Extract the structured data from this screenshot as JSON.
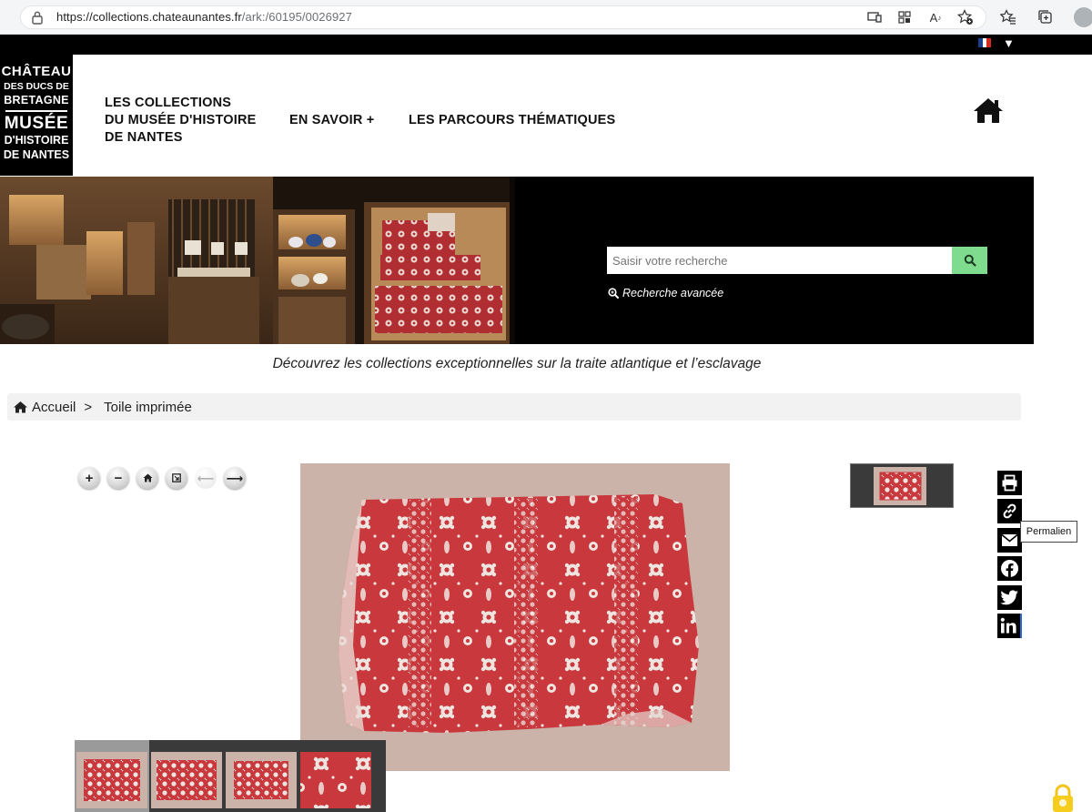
{
  "browser": {
    "url_host": "https://collections.chateaunantes.fr",
    "url_path": "/ark:/60195/0026927"
  },
  "language": {
    "current": "fr",
    "flag_colors": [
      "#1a3e8c",
      "#ffffff",
      "#d52b1e"
    ]
  },
  "logo": {
    "lines": [
      "CHÂTEAU",
      "DES DUCS DE",
      "BRETAGNE",
      "MUSÉE",
      "D'HISTOIRE",
      "DE NANTES"
    ]
  },
  "nav": {
    "collections": [
      "LES COLLECTIONS",
      "DU MUSÉE D'HISTOIRE",
      "DE NANTES"
    ],
    "savoir": "EN SAVOIR +",
    "parcours": "LES PARCOURS THÉMATIQUES"
  },
  "search": {
    "placeholder": "Saisir votre recherche",
    "advanced": "Recherche avancée",
    "button_color": "#7fdc8e"
  },
  "tagline": "Découvrez les collections exceptionnelles sur la traite atlantique et l’esclavage",
  "breadcrumb": {
    "home": "Accueil",
    "separator": ">",
    "current": "Toile imprimée"
  },
  "viewer": {
    "controls": [
      "zoom-in",
      "zoom-out",
      "home",
      "fullpage",
      "previous",
      "next"
    ],
    "zoom_in": "+",
    "zoom_out": "−",
    "prev": "⟵",
    "next": "⟶"
  },
  "share": {
    "items": [
      "print",
      "permalink",
      "email",
      "facebook",
      "twitter",
      "linkedin"
    ],
    "tooltip": "Permalien"
  },
  "colors": {
    "fabric_red": "#c8383c",
    "fabric_light": "#efe4df",
    "image_bg": "#cbb3a9"
  }
}
